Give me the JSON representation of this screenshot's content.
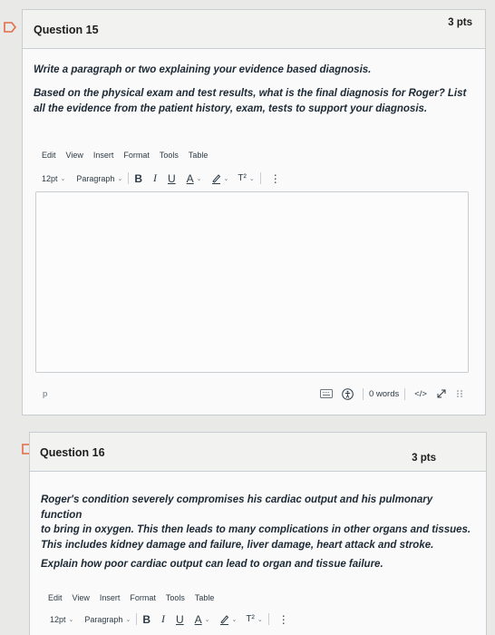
{
  "question15": {
    "title": "Question 15",
    "points": "3 pts",
    "prompt_line1": "Write a paragraph or two explaining your evidence based diagnosis.",
    "prompt_line2": "Based on the physical exam and test results, what is the final diagnosis for Roger? List",
    "prompt_line3": "all the evidence from the patient history, exam, tests to support your diagnosis.",
    "editor": {
      "menu": [
        "Edit",
        "View",
        "Insert",
        "Format",
        "Tools",
        "Table"
      ],
      "font_size": "12pt",
      "block_format": "Paragraph",
      "path": "p",
      "word_count": "0 words",
      "html_toggle": "</>"
    }
  },
  "question16": {
    "title": "Question 16",
    "points": "3 pts",
    "text_line1": "Roger's condition severely compromises his cardiac output and his pulmonary function",
    "text_line2": "to bring in oxygen. This then leads to many complications in other organs and tissues.",
    "text_line3": "This includes kidney damage and failure, liver damage, heart attack and stroke.",
    "prompt": "Explain how poor cardiac output can lead to organ and tissue failure.",
    "editor": {
      "menu": [
        "Edit",
        "View",
        "Insert",
        "Format",
        "Tools",
        "Table"
      ],
      "font_size": "12pt",
      "block_format": "Paragraph"
    }
  },
  "colors": {
    "background": "#e9e9e7",
    "card": "#fafafa",
    "card_header": "#f2f2f1",
    "border": "#c7cdd1",
    "flag": "#e36b47",
    "text": "#2d3b45"
  },
  "icons": {
    "bold": "B",
    "italic": "I",
    "underline": "U",
    "text_color": "A",
    "highlight": "pen-icon",
    "superscript": "T²",
    "more": "⋮",
    "fullscreen": "expand-icon",
    "resize": "resize-handle-icon"
  }
}
